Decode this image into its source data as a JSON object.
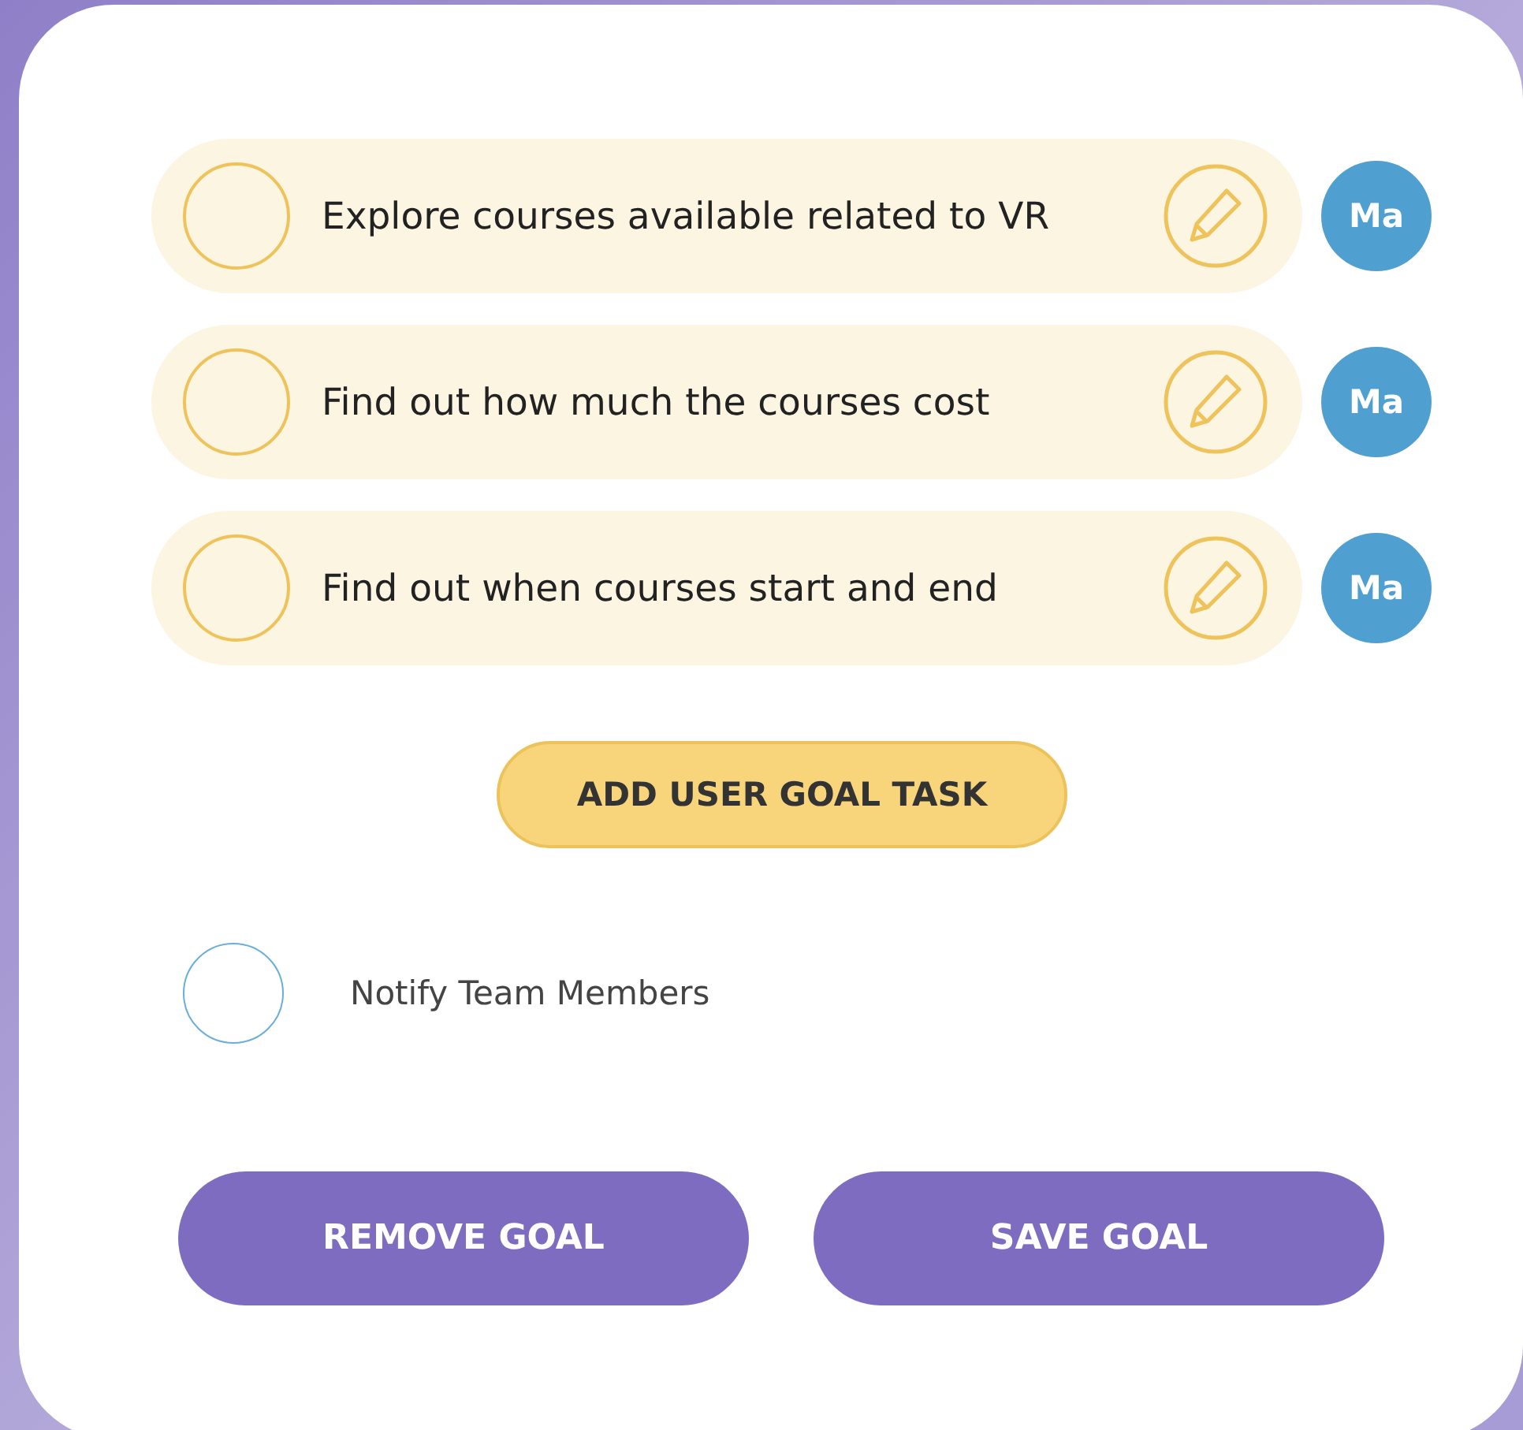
{
  "tasks": [
    {
      "text": "Explore courses available related to VR",
      "checked": false,
      "assignee": "Ma"
    },
    {
      "text": "Find out how much the courses cost",
      "checked": false,
      "assignee": "Ma"
    },
    {
      "text": "Find out when courses start and end",
      "checked": false,
      "assignee": "Ma"
    }
  ],
  "add_task_button": "ADD USER GOAL TASK",
  "notify": {
    "label": "Notify Team Members",
    "checked": false
  },
  "buttons": [
    "REMOVE GOAL",
    "SAVE GOAL"
  ]
}
